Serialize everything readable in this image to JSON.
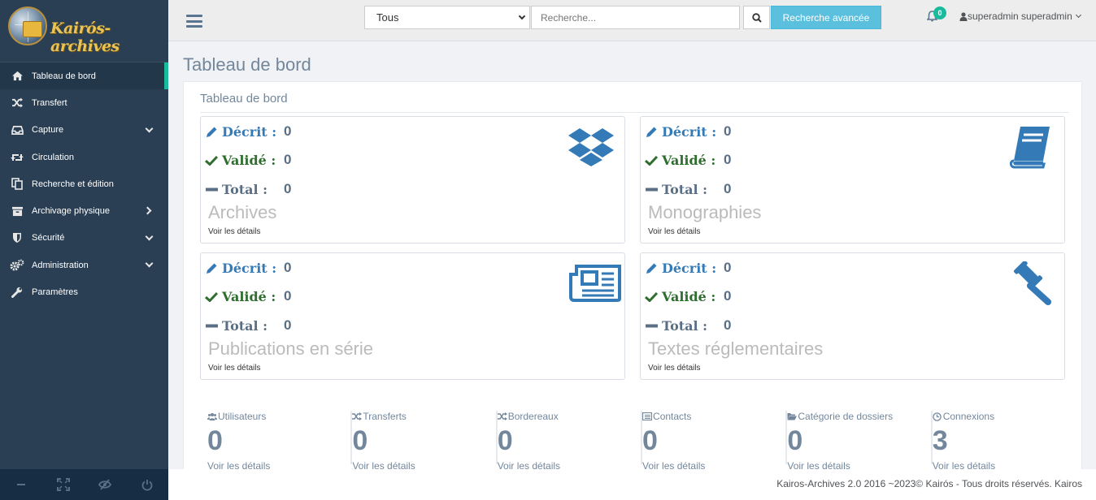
{
  "app": {
    "logo_text": "Kairós-archives"
  },
  "sidebar": {
    "items": [
      {
        "label": "Tableau de bord",
        "icon": "home-icon",
        "active": true
      },
      {
        "label": "Transfert",
        "icon": "shuffle-icon"
      },
      {
        "label": "Capture",
        "icon": "inbox-icon"
      },
      {
        "label": "Circulation",
        "icon": "retweet-icon"
      },
      {
        "label": "Recherche et édition",
        "icon": "copy-icon"
      },
      {
        "label": "Archivage physique",
        "icon": "archive-box-icon"
      },
      {
        "label": "Sécurité",
        "icon": "shield-icon"
      },
      {
        "label": "Administration",
        "icon": "gears-icon"
      },
      {
        "label": "Paramètres",
        "icon": "wrench-icon"
      }
    ],
    "footer_icons": [
      "settings-icon",
      "fullscreen-icon",
      "eye-slash-icon",
      "power-icon"
    ]
  },
  "topbar": {
    "scope": "Tous",
    "search_placeholder": "Recherche...",
    "advanced_label": "Recherche avancée",
    "notifications": "0",
    "user_name": "superadmin superadmin"
  },
  "main": {
    "page_title": "Tableau de bord",
    "panel_title": "Tableau de bord",
    "tiles": [
      {
        "name": "Archives",
        "decrit": "0",
        "valide": "0",
        "total": "0",
        "icon": "dropbox-icon"
      },
      {
        "name": "Monographies",
        "decrit": "0",
        "valide": "0",
        "total": "0",
        "icon": "book-icon"
      },
      {
        "name": "Publications en série",
        "decrit": "0",
        "valide": "0",
        "total": "0",
        "icon": "newspaper-icon"
      },
      {
        "name": "Textes réglementaires",
        "decrit": "0",
        "valide": "0",
        "total": "0",
        "icon": "gavel-icon"
      }
    ],
    "labels": {
      "decrit": "Décrit :",
      "valide": "Validé :",
      "total": "Total :",
      "details": "Voir les détails"
    },
    "stats": [
      {
        "label": "Utilisateurs",
        "value": "0",
        "icon": "users-icon"
      },
      {
        "label": "Transferts",
        "value": "0",
        "icon": "shuffle-icon"
      },
      {
        "label": "Bordereaux",
        "value": "0",
        "icon": "shuffle-icon"
      },
      {
        "label": "Contacts",
        "value": "0",
        "icon": "list-alt-icon"
      },
      {
        "label": "Catégorie de dossiers",
        "value": "0",
        "icon": "folder-open-icon"
      },
      {
        "label": "Connexions",
        "value": "3",
        "icon": "clock-icon"
      }
    ]
  },
  "footer": {
    "text": "Kairos-Archives 2.0 2016 ~2023© Kairós - Tous droits réservés. Kairos"
  },
  "colors": {
    "sidebar": "#2a3f54",
    "accent": "#1abb9c",
    "link_blue": "#337ab7",
    "check_green": "#2f6e2f",
    "search_button": "#5bc0de"
  }
}
